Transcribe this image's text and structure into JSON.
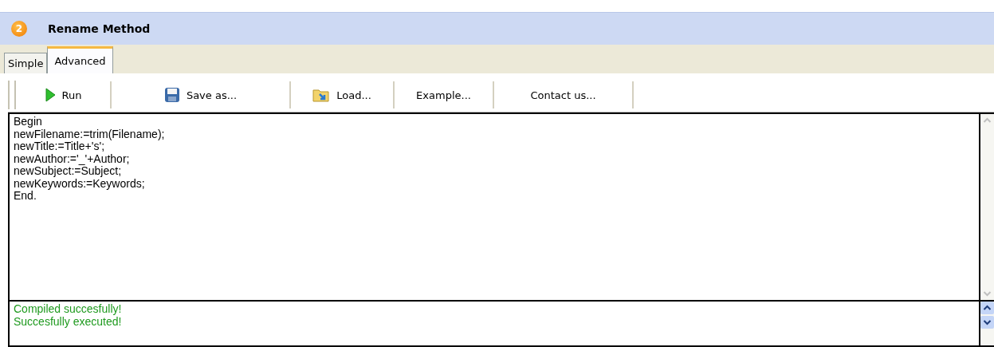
{
  "window": {
    "badge": "2",
    "title": "Rename Method"
  },
  "tabs": [
    {
      "label": "Simple",
      "selected": false
    },
    {
      "label": "Advanced",
      "selected": true
    }
  ],
  "toolbar": [
    {
      "label": "Run",
      "kind": "run"
    },
    {
      "label": "Save as...",
      "kind": "save"
    },
    {
      "label": "Load...",
      "kind": "load"
    },
    {
      "label": "Example...",
      "kind": "text"
    },
    {
      "label": "Contact us...",
      "kind": "text"
    }
  ],
  "editor": {
    "lines": [
      "Begin",
      "newFilename:=trim(Filename);",
      "newTitle:=Title+'s';",
      "newAuthor:='_'+Author;",
      "newSubject:=Subject;",
      "newKeywords:=Keywords;",
      "End."
    ]
  },
  "output": {
    "lines": [
      "Compiled succesfully!",
      "Succesfully executed!"
    ]
  }
}
